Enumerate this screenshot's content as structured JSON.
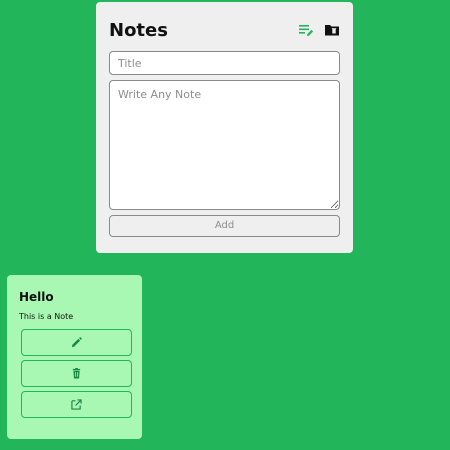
{
  "app": {
    "title": "Notes"
  },
  "icons": {
    "list_edit": "playlist-edit-icon",
    "folder": "folder-delete-icon",
    "edit": "pencil-icon",
    "delete": "trash-icon",
    "open": "open-in-new-icon"
  },
  "form": {
    "title_placeholder": "Title",
    "title_value": "",
    "note_placeholder": "Write Any Note",
    "note_value": "",
    "add_label": "Add"
  },
  "notes": [
    {
      "title": "Hello",
      "body": "This is a Note"
    }
  ],
  "colors": {
    "background": "#22b55a",
    "panel": "#efefef",
    "note_card": "#a8f7b3",
    "accent": "#22b55a"
  }
}
